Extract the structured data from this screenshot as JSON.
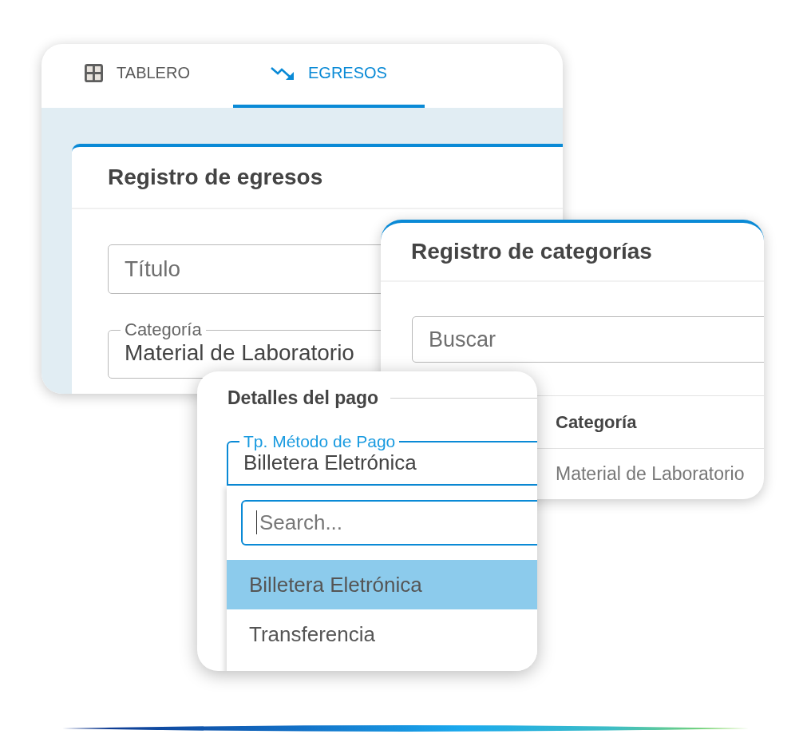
{
  "dashboard_window": {
    "tabs": [
      {
        "label": "TABLERO",
        "selected": false
      },
      {
        "label": "EGRESOS",
        "selected": true
      }
    ],
    "form": {
      "title": "Registro de egresos",
      "title_field": {
        "placeholder": "Título"
      },
      "category_field": {
        "label": "Categoría",
        "value": "Material de Laboratorio"
      }
    }
  },
  "categories_window": {
    "title": "Registro de categorías",
    "search": {
      "placeholder": "Buscar"
    },
    "table": {
      "columns": [
        "Categoría"
      ],
      "rows": [
        [
          "Material de Laboratorio"
        ]
      ]
    }
  },
  "payment_window": {
    "section_title": "Detalles del pago",
    "method_field": {
      "label": "Tp. Método de Pago",
      "value": "Billetera Eletrónica",
      "focused": true,
      "expanded": true
    },
    "dropdown": {
      "search": {
        "placeholder": "Search...",
        "focused": true
      },
      "options": [
        {
          "label": "Billetera Eletrónica",
          "selected": true
        },
        {
          "label": "Transferencia",
          "selected": false
        }
      ]
    }
  }
}
